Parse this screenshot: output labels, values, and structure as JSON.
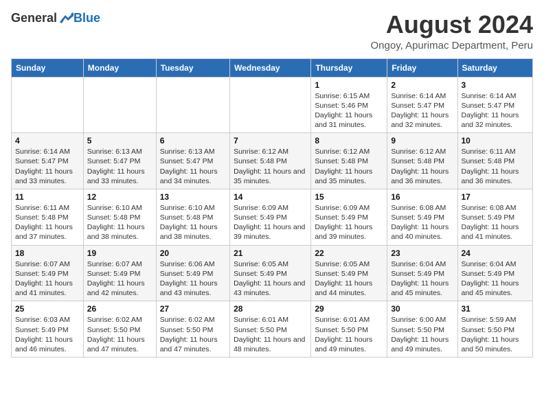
{
  "header": {
    "logo": {
      "general": "General",
      "blue": "Blue"
    },
    "title": "August 2024",
    "subtitle": "Ongoy, Apurimac Department, Peru"
  },
  "columns": [
    "Sunday",
    "Monday",
    "Tuesday",
    "Wednesday",
    "Thursday",
    "Friday",
    "Saturday"
  ],
  "weeks": [
    [
      {
        "day": "",
        "sunrise": "",
        "sunset": "",
        "daylight": ""
      },
      {
        "day": "",
        "sunrise": "",
        "sunset": "",
        "daylight": ""
      },
      {
        "day": "",
        "sunrise": "",
        "sunset": "",
        "daylight": ""
      },
      {
        "day": "",
        "sunrise": "",
        "sunset": "",
        "daylight": ""
      },
      {
        "day": "1",
        "sunrise": "Sunrise: 6:15 AM",
        "sunset": "Sunset: 5:46 PM",
        "daylight": "Daylight: 11 hours and 31 minutes."
      },
      {
        "day": "2",
        "sunrise": "Sunrise: 6:14 AM",
        "sunset": "Sunset: 5:47 PM",
        "daylight": "Daylight: 11 hours and 32 minutes."
      },
      {
        "day": "3",
        "sunrise": "Sunrise: 6:14 AM",
        "sunset": "Sunset: 5:47 PM",
        "daylight": "Daylight: 11 hours and 32 minutes."
      }
    ],
    [
      {
        "day": "4",
        "sunrise": "Sunrise: 6:14 AM",
        "sunset": "Sunset: 5:47 PM",
        "daylight": "Daylight: 11 hours and 33 minutes."
      },
      {
        "day": "5",
        "sunrise": "Sunrise: 6:13 AM",
        "sunset": "Sunset: 5:47 PM",
        "daylight": "Daylight: 11 hours and 33 minutes."
      },
      {
        "day": "6",
        "sunrise": "Sunrise: 6:13 AM",
        "sunset": "Sunset: 5:47 PM",
        "daylight": "Daylight: 11 hours and 34 minutes."
      },
      {
        "day": "7",
        "sunrise": "Sunrise: 6:12 AM",
        "sunset": "Sunset: 5:48 PM",
        "daylight": "Daylight: 11 hours and 35 minutes."
      },
      {
        "day": "8",
        "sunrise": "Sunrise: 6:12 AM",
        "sunset": "Sunset: 5:48 PM",
        "daylight": "Daylight: 11 hours and 35 minutes."
      },
      {
        "day": "9",
        "sunrise": "Sunrise: 6:12 AM",
        "sunset": "Sunset: 5:48 PM",
        "daylight": "Daylight: 11 hours and 36 minutes."
      },
      {
        "day": "10",
        "sunrise": "Sunrise: 6:11 AM",
        "sunset": "Sunset: 5:48 PM",
        "daylight": "Daylight: 11 hours and 36 minutes."
      }
    ],
    [
      {
        "day": "11",
        "sunrise": "Sunrise: 6:11 AM",
        "sunset": "Sunset: 5:48 PM",
        "daylight": "Daylight: 11 hours and 37 minutes."
      },
      {
        "day": "12",
        "sunrise": "Sunrise: 6:10 AM",
        "sunset": "Sunset: 5:48 PM",
        "daylight": "Daylight: 11 hours and 38 minutes."
      },
      {
        "day": "13",
        "sunrise": "Sunrise: 6:10 AM",
        "sunset": "Sunset: 5:48 PM",
        "daylight": "Daylight: 11 hours and 38 minutes."
      },
      {
        "day": "14",
        "sunrise": "Sunrise: 6:09 AM",
        "sunset": "Sunset: 5:49 PM",
        "daylight": "Daylight: 11 hours and 39 minutes."
      },
      {
        "day": "15",
        "sunrise": "Sunrise: 6:09 AM",
        "sunset": "Sunset: 5:49 PM",
        "daylight": "Daylight: 11 hours and 39 minutes."
      },
      {
        "day": "16",
        "sunrise": "Sunrise: 6:08 AM",
        "sunset": "Sunset: 5:49 PM",
        "daylight": "Daylight: 11 hours and 40 minutes."
      },
      {
        "day": "17",
        "sunrise": "Sunrise: 6:08 AM",
        "sunset": "Sunset: 5:49 PM",
        "daylight": "Daylight: 11 hours and 41 minutes."
      }
    ],
    [
      {
        "day": "18",
        "sunrise": "Sunrise: 6:07 AM",
        "sunset": "Sunset: 5:49 PM",
        "daylight": "Daylight: 11 hours and 41 minutes."
      },
      {
        "day": "19",
        "sunrise": "Sunrise: 6:07 AM",
        "sunset": "Sunset: 5:49 PM",
        "daylight": "Daylight: 11 hours and 42 minutes."
      },
      {
        "day": "20",
        "sunrise": "Sunrise: 6:06 AM",
        "sunset": "Sunset: 5:49 PM",
        "daylight": "Daylight: 11 hours and 43 minutes."
      },
      {
        "day": "21",
        "sunrise": "Sunrise: 6:05 AM",
        "sunset": "Sunset: 5:49 PM",
        "daylight": "Daylight: 11 hours and 43 minutes."
      },
      {
        "day": "22",
        "sunrise": "Sunrise: 6:05 AM",
        "sunset": "Sunset: 5:49 PM",
        "daylight": "Daylight: 11 hours and 44 minutes."
      },
      {
        "day": "23",
        "sunrise": "Sunrise: 6:04 AM",
        "sunset": "Sunset: 5:49 PM",
        "daylight": "Daylight: 11 hours and 45 minutes."
      },
      {
        "day": "24",
        "sunrise": "Sunrise: 6:04 AM",
        "sunset": "Sunset: 5:49 PM",
        "daylight": "Daylight: 11 hours and 45 minutes."
      }
    ],
    [
      {
        "day": "25",
        "sunrise": "Sunrise: 6:03 AM",
        "sunset": "Sunset: 5:49 PM",
        "daylight": "Daylight: 11 hours and 46 minutes."
      },
      {
        "day": "26",
        "sunrise": "Sunrise: 6:02 AM",
        "sunset": "Sunset: 5:50 PM",
        "daylight": "Daylight: 11 hours and 47 minutes."
      },
      {
        "day": "27",
        "sunrise": "Sunrise: 6:02 AM",
        "sunset": "Sunset: 5:50 PM",
        "daylight": "Daylight: 11 hours and 47 minutes."
      },
      {
        "day": "28",
        "sunrise": "Sunrise: 6:01 AM",
        "sunset": "Sunset: 5:50 PM",
        "daylight": "Daylight: 11 hours and 48 minutes."
      },
      {
        "day": "29",
        "sunrise": "Sunrise: 6:01 AM",
        "sunset": "Sunset: 5:50 PM",
        "daylight": "Daylight: 11 hours and 49 minutes."
      },
      {
        "day": "30",
        "sunrise": "Sunrise: 6:00 AM",
        "sunset": "Sunset: 5:50 PM",
        "daylight": "Daylight: 11 hours and 49 minutes."
      },
      {
        "day": "31",
        "sunrise": "Sunrise: 5:59 AM",
        "sunset": "Sunset: 5:50 PM",
        "daylight": "Daylight: 11 hours and 50 minutes."
      }
    ]
  ]
}
